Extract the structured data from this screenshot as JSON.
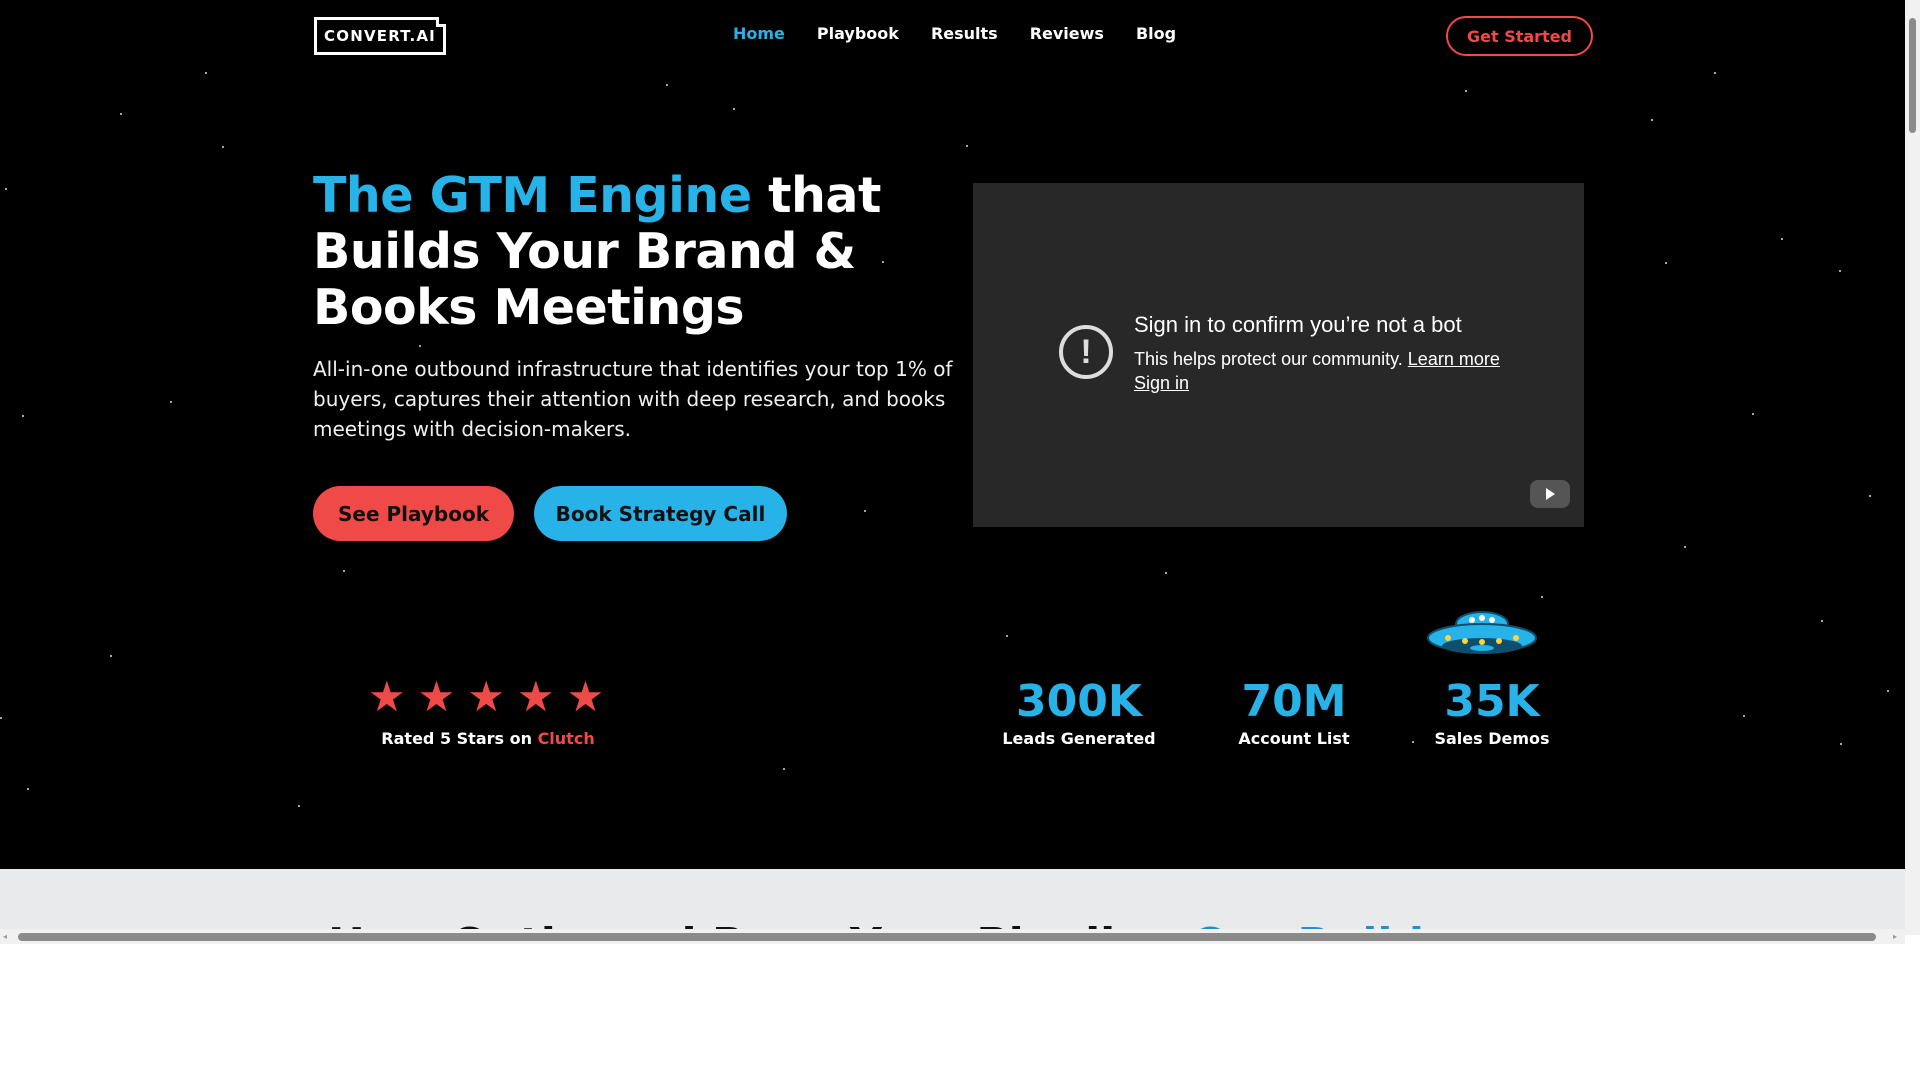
{
  "header": {
    "logo": "CONVERT.AI",
    "nav": [
      "Home",
      "Playbook",
      "Results",
      "Reviews",
      "Blog"
    ],
    "cta": "Get Started"
  },
  "hero": {
    "title_accent": "The GTM Engine",
    "title_rest_1": " that",
    "title_rest_2": "Builds Your Brand &",
    "title_rest_3": "Books Meetings",
    "subtitle": "All-in-one outbound infrastructure that identifies your top 1% of buyers, captures their attention with deep research, and books meetings with decision-makers.",
    "primary_button": "See Playbook",
    "secondary_button": "Book Strategy Call"
  },
  "video": {
    "title": "Sign in to confirm you’re not a bot",
    "text": "This helps protect our community.",
    "learn_more": "Learn more",
    "sign_in": "Sign in"
  },
  "rating": {
    "stars": 5,
    "text": "Rated 5 Stars on",
    "brand": "Clutch"
  },
  "stats": [
    {
      "value": "300K",
      "label": "Leads Generated"
    },
    {
      "value": "70M",
      "label": "Account List"
    },
    {
      "value": "35K",
      "label": "Sales Demos"
    }
  ],
  "section2": {
    "title": "How Outbound Runs Your Pipeline",
    "title_accent": "Our Build"
  },
  "colors": {
    "accent_blue": "#27b2e8",
    "accent_red": "#f04a48",
    "background": "#000000"
  }
}
